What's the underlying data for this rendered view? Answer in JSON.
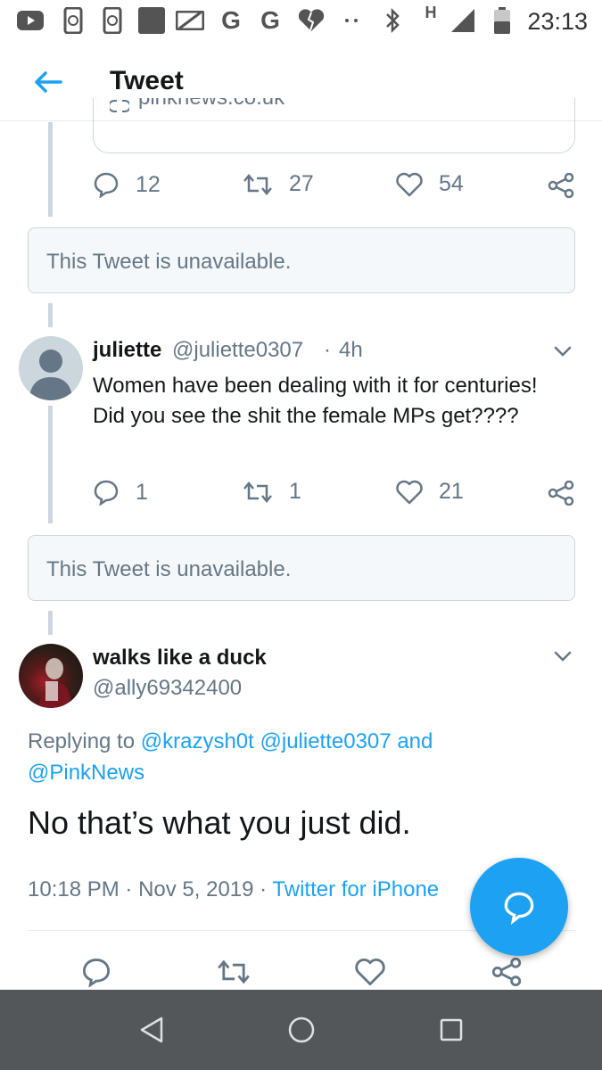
{
  "status_bar": {
    "time": "23:13",
    "network_letter": "H",
    "icons": [
      "youtube-icon",
      "phone-sync-icon",
      "phone-sync-icon",
      "square-app-icon",
      "photo-off-icon",
      "google-icon",
      "google-icon",
      "broken-heart-icon",
      "more-dots-icon",
      "bluetooth-icon",
      "signal-icon",
      "battery-icon"
    ],
    "google_letter": "G"
  },
  "header": {
    "title": "Tweet",
    "back_icon": "back-arrow-icon"
  },
  "link_card": {
    "domain": "pinknews.co.uk"
  },
  "first_tweet_actions": {
    "replies": "12",
    "retweets": "27",
    "likes": "54"
  },
  "unavailable_1": {
    "text": "This Tweet is unavailable."
  },
  "juliette_tweet": {
    "name": "juliette",
    "handle": "@juliette0307",
    "separator": "·",
    "time": "4h",
    "text": "Women have been dealing with it for centuries! Did you see the shit the female MPs get????",
    "replies": "1",
    "retweets": "1",
    "likes": "21"
  },
  "unavailable_2": {
    "text": "This Tweet is unavailable."
  },
  "main_tweet": {
    "name": "walks like a duck",
    "handle": "@ally69342400",
    "replying_prefix": "Replying to",
    "mention_1": "@krazysh0t",
    "mention_2": "@juliette0307",
    "conjunction": "and",
    "mention_3": "@PinkNews",
    "text": "No that’s what you just did.",
    "time": "10:18 PM",
    "dot": "·",
    "date": "Nov 5, 2019",
    "source": "Twitter for iPhone"
  },
  "colors": {
    "accent": "#1da1f2",
    "text_primary": "#14171a",
    "text_secondary": "#657786",
    "border": "#ccd6dd",
    "nav_bar": "#54575a"
  }
}
